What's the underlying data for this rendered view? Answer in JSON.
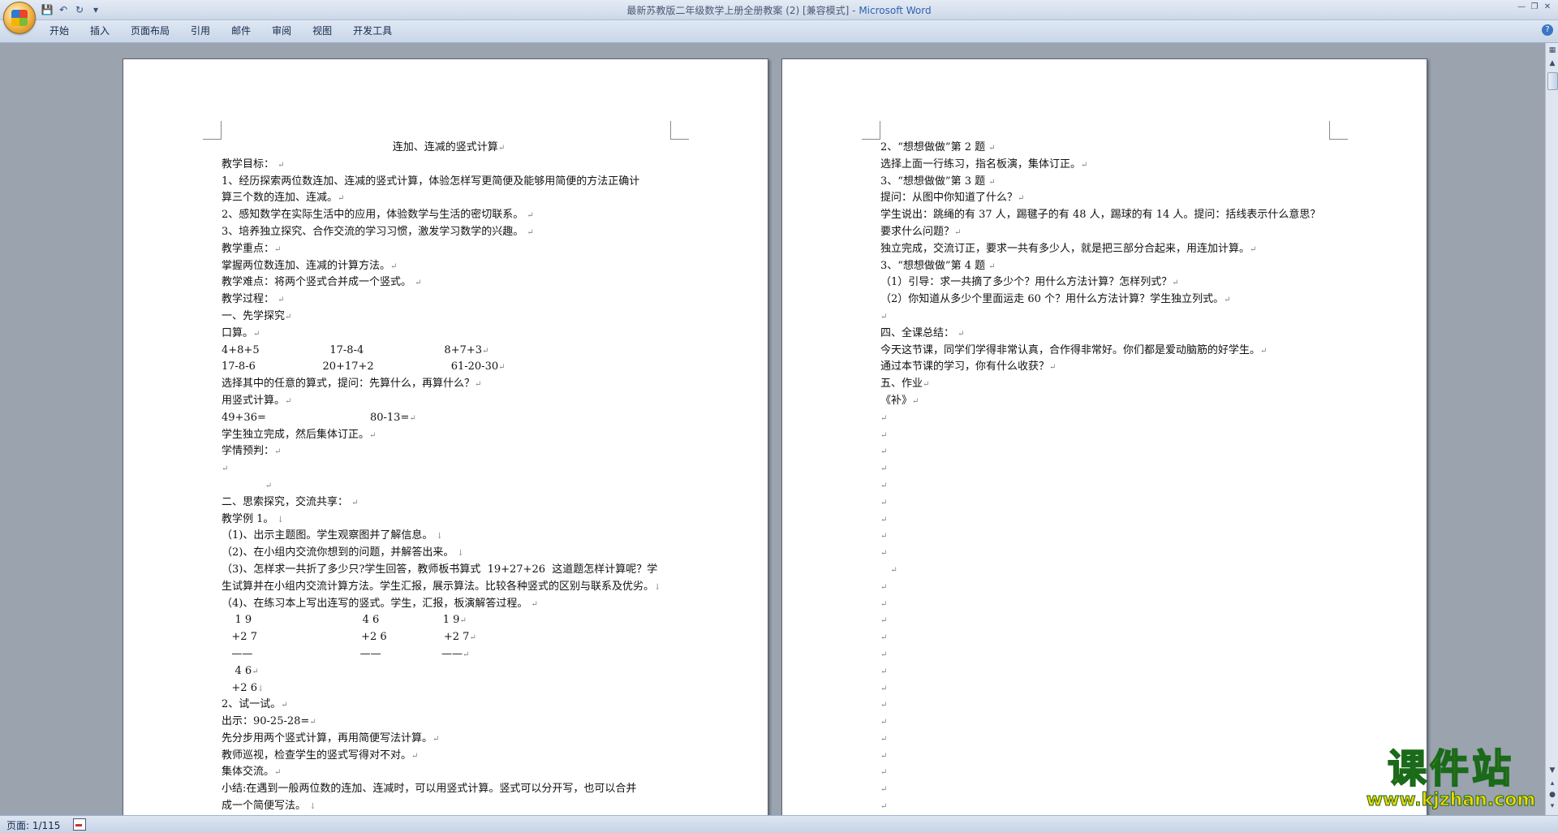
{
  "window": {
    "title": "最新苏教版二年级数学上册全册教案 (2) [兼容模式] - ",
    "app": "Microsoft Word"
  },
  "icons": {
    "office": "office-button-icon",
    "save": "save-icon",
    "undo": "undo-icon",
    "redo": "redo-icon",
    "customize": "dropdown-icon",
    "help": "help-icon"
  },
  "ribbon": {
    "tabs": [
      "开始",
      "插入",
      "页面布局",
      "引用",
      "邮件",
      "审阅",
      "视图",
      "开发工具"
    ]
  },
  "help_label": "?",
  "status": {
    "page": "页面: 1/115"
  },
  "watermark": {
    "text": "课件站",
    "url": "www.kjzhan.com"
  },
  "pages": [
    {
      "lines": [
        {
          "t": "连加、连减的竖式计算",
          "m": "↵",
          "c": true
        },
        {
          "t": "教学目标： ",
          "m": "↵"
        },
        {
          "t": "1、经历探索两位数连加、连减的竖式计算，体验怎样写更简便及能够用简便的方法正确计",
          "m": ""
        },
        {
          "t": "算三个数的连加、连减。",
          "m": "↵"
        },
        {
          "t": "2、感知数学在实际生活中的应用，体验数学与生活的密切联系。 ",
          "m": "↵"
        },
        {
          "t": "3、培养独立探究、合作交流的学习习惯，激发学习数学的兴趣。 ",
          "m": "↵"
        },
        {
          "t": "教学重点：",
          "m": "↵"
        },
        {
          "t": "掌握两位数连加、连减的计算方法。",
          "m": "↵"
        },
        {
          "t": "教学难点：将两个竖式合并成一个竖式。 ",
          "m": "↵"
        },
        {
          "t": "教学过程： ",
          "m": "↵"
        },
        {
          "t": "一、先学探究",
          "m": "↵"
        },
        {
          "t": "口算。",
          "m": "↵"
        },
        {
          "t": "4+8+5                     17-8-4                        8+7+3",
          "m": "↵"
        },
        {
          "t": "17-8-6                    20+17+2                       61-20-30",
          "m": "↵"
        },
        {
          "t": "选择其中的任意的算式，提问：先算什么，再算什么？",
          "m": "↵"
        },
        {
          "t": "用竖式计算。",
          "m": "↵"
        },
        {
          "t": "49+36=                               80-13=",
          "m": "↵"
        },
        {
          "t": "学生独立完成，然后集体订正。",
          "m": "↵"
        },
        {
          "t": "学情预判：",
          "m": "↵"
        },
        {
          "t": "",
          "m": "↵"
        },
        {
          "t": "             ",
          "m": "↵"
        },
        {
          "t": "二、思索探究，交流共享： ",
          "m": "↵"
        },
        {
          "t": "教学例 1。 ",
          "m": "↓"
        },
        {
          "t": "（1)、出示主题图。学生观察图并了解信息。 ",
          "m": "↓"
        },
        {
          "t": "（2)、在小组内交流你想到的问题，并解答出来。 ",
          "m": "↓"
        },
        {
          "t": "（3)、怎样求一共折了多少只?学生回答，教师板书算式  19+27+26  这道题怎样计算呢？学",
          "m": ""
        },
        {
          "t": "生试算并在小组内交流计算方法。学生汇报，展示算法。比较各种竖式的区别与联系及优劣。",
          "m": "↓"
        },
        {
          "t": "（4)、在练习本上写出连写的竖式。学生，汇报，板演解答过程。 ",
          "m": "↵"
        },
        {
          "t": "    1 9                                 4 6                   1 9",
          "m": "↵"
        },
        {
          "t": "   +2 7                               +2 6                 +2 7",
          "m": "↵"
        },
        {
          "t": "   ——                                ——                  ——",
          "m": "↵"
        },
        {
          "t": "    4 6",
          "m": "↵"
        },
        {
          "t": "   +2 6",
          "m": "↓"
        },
        {
          "t": "2、试一试。",
          "m": "↵"
        },
        {
          "t": "出示：90-25-28=",
          "m": "↵"
        },
        {
          "t": "先分步用两个竖式计算，再用简便写法计算。",
          "m": "↵"
        },
        {
          "t": "教师巡视，检查学生的竖式写得对不对。",
          "m": "↵"
        },
        {
          "t": "集体交流。",
          "m": "↵"
        },
        {
          "t": "小结:在遇到一般两位数的连加、连减时，可以用竖式计算。竖式可以分开写，也可以合并",
          "m": ""
        },
        {
          "t": "成一个简便写法。 ",
          "m": "↓"
        }
      ]
    },
    {
      "lines": [
        {
          "t": "2、“想想做做”第 2 题 ",
          "m": "↵"
        },
        {
          "t": "选择上面一行练习，指名板演，集体订正。",
          "m": "↵"
        },
        {
          "t": "3、“想想做做”第 3 题 ",
          "m": "↵"
        },
        {
          "t": "提问：从图中你知道了什么？",
          "m": "↵"
        },
        {
          "t": "学生说出：跳绳的有 37 人，踢毽子的有 48 人，踢球的有 14 人。提问：括线表示什么意思？",
          "m": ""
        },
        {
          "t": "要求什么问题？",
          "m": "↵"
        },
        {
          "t": "独立完成，交流订正，要求一共有多少人，就是把三部分合起来，用连加计算。",
          "m": "↵"
        },
        {
          "t": "3、“想想做做”第 4 题 ",
          "m": "↵"
        },
        {
          "t": "（1）引导：求一共摘了多少个？用什么方法计算？怎样列式？",
          "m": "↵"
        },
        {
          "t": "（2）你知道从多少个里面运走 60 个？用什么方法计算？学生独立列式。",
          "m": "↵"
        },
        {
          "t": "",
          "m": "↵"
        },
        {
          "t": "四、全课总结： ",
          "m": "↵"
        },
        {
          "t": "今天这节课，同学们学得非常认真，合作得非常好。你们都是爱动脑筋的好学生。",
          "m": "↵"
        },
        {
          "t": "通过本节课的学习，你有什么收获？",
          "m": "↵"
        },
        {
          "t": "五、作业",
          "m": "↵"
        },
        {
          "t": "《补》",
          "m": "↵"
        },
        {
          "t": "",
          "m": "↵"
        },
        {
          "t": "",
          "m": "↵"
        },
        {
          "t": "",
          "m": "↵"
        },
        {
          "t": "",
          "m": "↵"
        },
        {
          "t": "",
          "m": "↵"
        },
        {
          "t": "",
          "m": "↵"
        },
        {
          "t": "",
          "m": "↵"
        },
        {
          "t": "",
          "m": "↵"
        },
        {
          "t": "",
          "m": "↵"
        },
        {
          "t": "   ",
          "m": "↵"
        },
        {
          "t": "",
          "m": "↵"
        },
        {
          "t": "",
          "m": "↵"
        },
        {
          "t": "",
          "m": "↵"
        },
        {
          "t": "",
          "m": "↵"
        },
        {
          "t": "",
          "m": "↵"
        },
        {
          "t": "",
          "m": "↵"
        },
        {
          "t": "",
          "m": "↵"
        },
        {
          "t": "",
          "m": "↵"
        },
        {
          "t": "",
          "m": "↵"
        },
        {
          "t": "",
          "m": "↵"
        },
        {
          "t": "",
          "m": "↵"
        },
        {
          "t": "",
          "m": "↵"
        },
        {
          "t": "",
          "m": "↵"
        },
        {
          "t": "",
          "m": "↵"
        }
      ]
    }
  ]
}
